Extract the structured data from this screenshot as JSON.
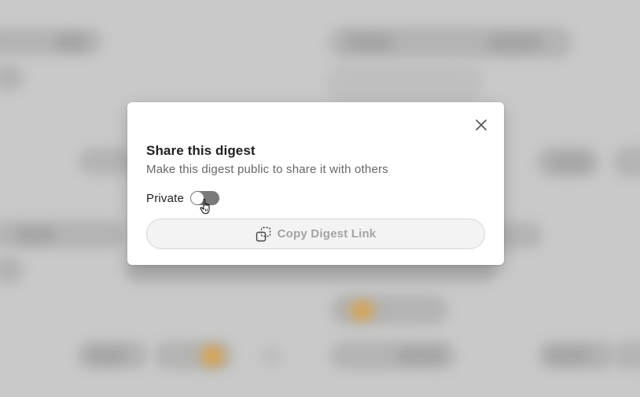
{
  "dialog": {
    "title": "Share this digest",
    "subtitle": "Make this digest public to share it with others",
    "close_icon": "close-icon"
  },
  "visibility_toggle": {
    "label": "Private",
    "state": "off"
  },
  "copy_button": {
    "label": "Copy Digest Link",
    "icon": "copy-link-icon",
    "state": "disabled"
  },
  "colors": {
    "overlay": "#c8c9c8",
    "toggle_off": "#7a7a7a",
    "disabled_text": "#a4a4a4",
    "title_text": "#1f1f1f",
    "subtitle_text": "#666666"
  }
}
